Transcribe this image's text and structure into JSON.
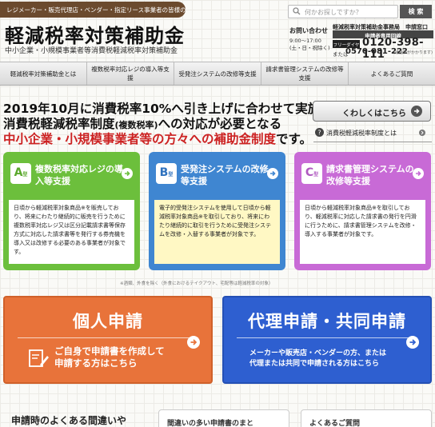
{
  "header": {
    "vendor_link": "レジメーカー・販売代理店・ベンダー・指定リース事業者の皆様のページはこちら",
    "title": "軽減税率対策補助金",
    "subtitle": "中小企業・小規模事業者等消費税軽減税率対策補助金",
    "search_placeholder": "何かお探しですか？",
    "search_button": "検 索"
  },
  "contact": {
    "title": "お問い合わせ",
    "hours_line1": "9:00～17:00",
    "hours_line2": "(土・日・祝除く)",
    "office": "軽減税率対策補助金事務局　申請窓口",
    "dedicated_line": "申請者専用回線",
    "freedial_label": "フリーダイヤル",
    "freedial_number": "0120-398-111",
    "alt_label": "または",
    "alt_number": "0570-081-222",
    "alt_note": "(通話料がかかります)"
  },
  "nav": [
    {
      "label": "軽減税率対策補助金とは"
    },
    {
      "label": "複数税率対応レジの導入等支援"
    },
    {
      "label": "受発注システムの改修等支援"
    },
    {
      "label": "請求書管理システムの改修等支援"
    },
    {
      "label": "よくあるご質問"
    }
  ],
  "hero": {
    "line1": "2019年10月に消費税率10%へ引き上げに合わせて実施される",
    "line2_main": "消費税軽減税率制度",
    "line2_paren": "(複数税率)",
    "line2_tail": "への対応が必要となる",
    "line3_main": "中小企業・小規模事業者等の方々への補助金制度",
    "line3_tail": "です。",
    "details_button": "くわしくはこちら",
    "about_link": "消費税軽減税率制度とは"
  },
  "cards": [
    {
      "type_letter": "A",
      "type_suffix": "型",
      "title": "複数税率対応レジの導入等支援",
      "body": "日頃から軽減税率対象商品※を販売しており、将来にわたり継続的に販売を行うために複数税率対応レジ又は区分記載請求書等保存方式に対応した請求書等を発行する券売機を導入又は改修する必要のある事業者が対象です。"
    },
    {
      "type_letter": "B",
      "type_suffix": "型",
      "title": "受発注システムの改修等支援",
      "body": "電子的受発注システムを使用して日頃から軽減税率対象商品※を取引しており、将来にわたり継続的に取引を行うために受発注システムを改修・入替する事業者が対象です。"
    },
    {
      "type_letter": "C",
      "type_suffix": "型",
      "title": "請求書管理システムの改修等支援",
      "body": "日頃から軽減税率対象商品※を取引しており、軽減税率に対応した請求書の発行を円滑に行うために、請求書管理システムを改修・導入する事業者が対象です。"
    }
  ],
  "footnote": "※酒類、外食を除く（外食におけるテイクアウト、宅配等は軽減税率の対象）",
  "apply": {
    "personal_head": "個人申請",
    "personal_desc_line1": "ご自身で申請書を作成して",
    "personal_desc_line2": "申請する方はこちら",
    "agent_head": "代理申請・共同申請",
    "agent_desc_line1": "メーカーや販売店・ベンダーの方、または",
    "agent_desc_line2": "代理または共同で申請される方はこちら"
  },
  "faq": {
    "heading": "申請時のよくある間違いや",
    "card1": "間違いの多い申請書のまと",
    "card2": "よくあるご質問"
  },
  "colors": {
    "brown": "#6b4a2e",
    "type_a": "#6cbf3c",
    "type_b": "#3f86d1",
    "type_c": "#c86ad6",
    "personal": "#e8733a",
    "agent": "#2e5fd0",
    "accent_red": "#cc2222"
  }
}
